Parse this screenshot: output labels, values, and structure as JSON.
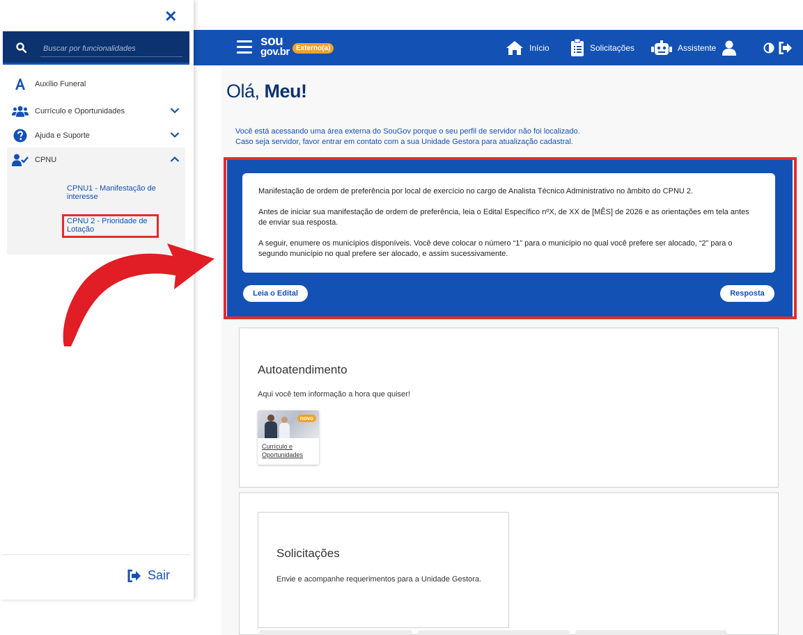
{
  "header": {
    "logo_line1": "sou",
    "logo_line2": "gov.br",
    "badge": "Externo(a)",
    "nav_inicio": "Início",
    "nav_solicitacoes": "Solicitações",
    "nav_assistente": "Assistente"
  },
  "main": {
    "greeting_prefix": "Olá,",
    "greeting_name": "Meu!",
    "notice_line1": "Você está acessando uma área externa do SouGov porque o seu perfil de servidor não foi localizado.",
    "notice_line2": "Caso seja servidor, favor entrar em contato com a sua Unidade Gestora para atualização cadastral.",
    "panel": {
      "p1": "Manifestação de ordem de preferência por local de exercício no cargo de Analista Técnico Administrativo no âmbito do CPNU 2.",
      "p2": "Antes de iniciar sua manifestação de ordem de preferência, leia o Edital Específico nºX, de XX de [MÊS] de 2026 e as orientações em tela antes de enviar sua resposta.",
      "p3": "A seguir, enumere os municípios disponíveis. Você deve colocar o número “1” para o município no qual você prefere ser alocado, “2” para o segundo município no qual prefere ser alocado, e assim sucessivamente.",
      "btn_edital": "Leia o Edital",
      "btn_resposta": "Resposta"
    },
    "autoatendimento": {
      "title": "Autoatendimento",
      "subtitle": "Aqui você tem informação a hora que quiser!",
      "card_badge": "novo",
      "card_label": "Currículo e Oportunidades"
    },
    "solicitacoes": {
      "title": "Solicitações",
      "desc": "Envie e acompanhe requerimentos para a Unidade Gestora."
    }
  },
  "sidebar": {
    "search_placeholder": "Buscar por funcionalidades",
    "items": [
      {
        "label": "Auxílio Funeral"
      },
      {
        "label": "Currículo e Oportunidades"
      },
      {
        "label": "Ajuda e Suporte"
      },
      {
        "label": "CPNU"
      }
    ],
    "cpnu_sub1": "CPNU1 - Manifestação de interesse",
    "cpnu_sub2": "CPNU 2 - Prioridade de Lotação",
    "logout": "Sair"
  },
  "colors": {
    "primary": "#1351b4",
    "dark_blue": "#0c326f",
    "badge_orange": "#f0a328",
    "highlight_red": "#e52b2b"
  }
}
